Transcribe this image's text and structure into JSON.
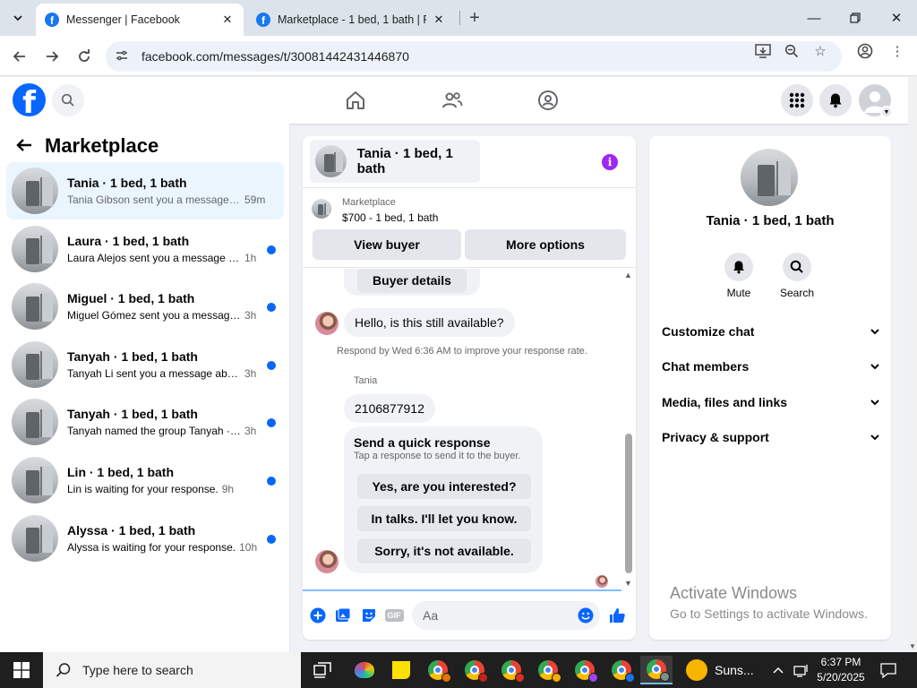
{
  "browser": {
    "tabs": [
      {
        "title": "Messenger | Facebook",
        "active": true
      },
      {
        "title": "Marketplace - 1 bed, 1 bath | Fa",
        "active": false
      }
    ],
    "url": "facebook.com/messages/t/30081442431446870",
    "icons": {
      "back": "arrow-left",
      "forward": "arrow-right",
      "reload": "reload",
      "install": "install-app",
      "zoom": "zoom-out",
      "bookmark": "star",
      "profile": "account",
      "menu": "kebab"
    }
  },
  "fb": {
    "brand_color": "#0866ff",
    "left": {
      "title": "Marketplace",
      "conversations": [
        {
          "name": "Tania · 1 bed, 1 bath",
          "snippet": "Tania Gibson sent you a message ab...",
          "time": "59m",
          "active": true,
          "unread": false
        },
        {
          "name": "Laura · 1 bed, 1 bath",
          "snippet": "Laura Alejos sent you a message a...",
          "time": "1h",
          "active": false,
          "unread": true
        },
        {
          "name": "Miguel · 1 bed, 1 bath",
          "snippet": "Miguel Gómez sent you a message...",
          "time": "3h",
          "active": false,
          "unread": true
        },
        {
          "name": "Tanyah · 1 bed, 1 bath",
          "snippet": "Tanyah Li sent you a message abo...",
          "time": "3h",
          "active": false,
          "unread": true
        },
        {
          "name": "Tanyah · 1 bed, 1 bath",
          "snippet": "Tanyah named the group Tanyah · ...",
          "time": "3h",
          "active": false,
          "unread": true
        },
        {
          "name": "Lin · 1 bed, 1 bath",
          "snippet": "Lin is waiting for your response.",
          "time": "9h",
          "active": false,
          "unread": true
        },
        {
          "name": "Alyssa · 1 bed, 1 bath",
          "snippet": "Alyssa is waiting for your response.",
          "time": "10h",
          "active": false,
          "unread": true
        }
      ]
    },
    "chat": {
      "title": "Tania · 1 bed, 1 bath",
      "listing_source": "Marketplace",
      "listing_price": "$700 - 1 bed, 1 bath",
      "view_buyer": "View buyer",
      "more_options": "More options",
      "buyer_details": "Buyer details",
      "message1": "Hello, is this still available?",
      "notice": "Respond by Wed 6:36 AM to improve your response rate.",
      "sender": "Tania",
      "message2": "2106877912",
      "quick_title": "Send a quick response",
      "quick_sub": "Tap a response to send it to the buyer.",
      "quick_replies": [
        "Yes, are you interested?",
        "In talks. I'll let you know.",
        "Sorry, it's not available."
      ],
      "input_placeholder": "Aa"
    },
    "right": {
      "name": "Tania · 1 bed, 1 bath",
      "mute": "Mute",
      "search": "Search",
      "sections": [
        "Customize chat",
        "Chat members",
        "Media, files and links",
        "Privacy & support"
      ]
    }
  },
  "watermark": {
    "line1": "Activate Windows",
    "line2": "Go to Settings to activate Windows."
  },
  "taskbar": {
    "search_placeholder": "Type here to search",
    "weather": "Suns...",
    "time": "6:37 PM",
    "date": "5/20/2025"
  }
}
